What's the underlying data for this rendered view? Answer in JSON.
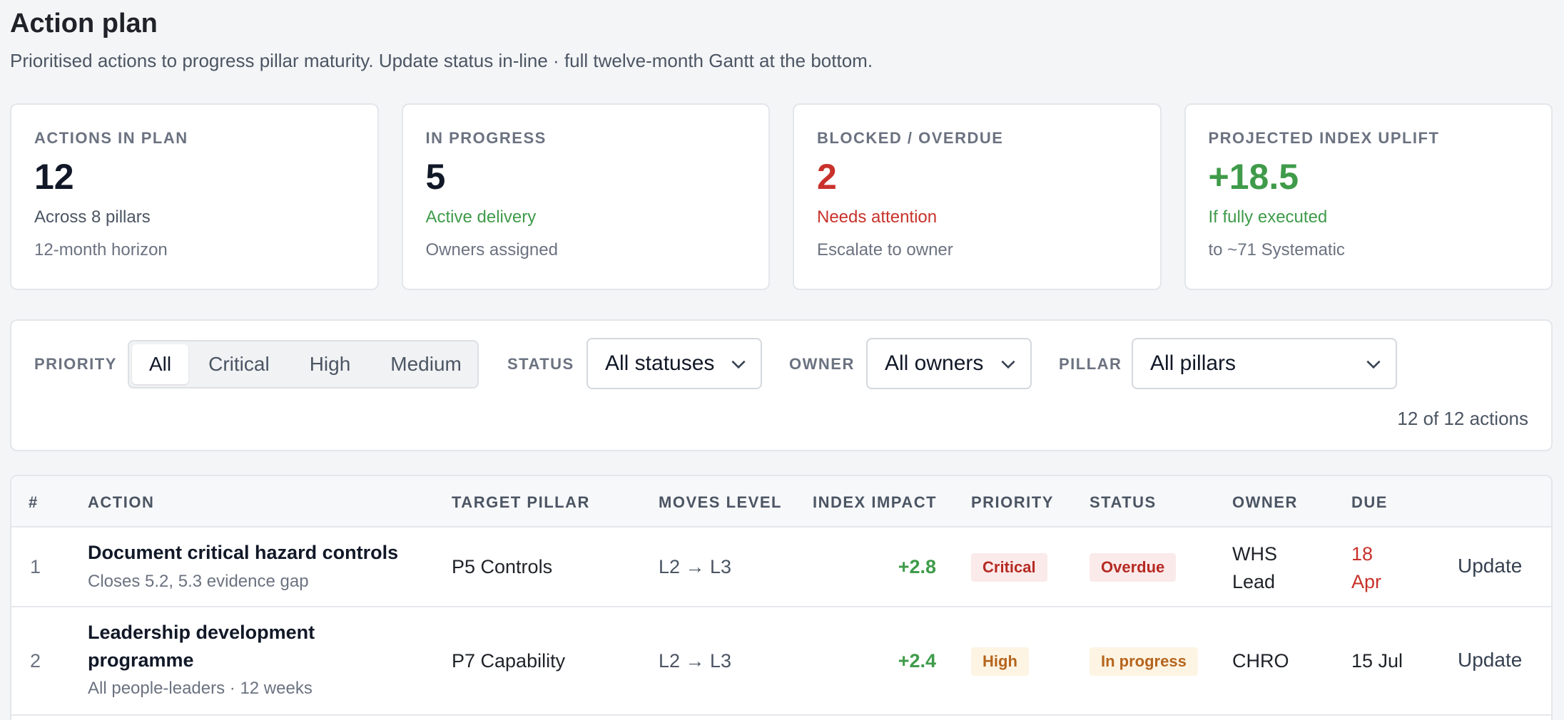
{
  "header": {
    "title": "Action plan",
    "subtitle": "Prioritised actions to progress pillar maturity. Update status in-line · full twelve-month Gantt at the bottom."
  },
  "kpis": [
    {
      "label": "ACTIONS IN PLAN",
      "value": "12",
      "line1": "Across 8 pillars",
      "line2": "12-month horizon"
    },
    {
      "label": "IN PROGRESS",
      "value": "5",
      "line1": "Active delivery",
      "line2": "Owners assigned"
    },
    {
      "label": "BLOCKED / OVERDUE",
      "value": "2",
      "line1": "Needs attention",
      "line2": "Escalate to owner"
    },
    {
      "label": "PROJECTED INDEX UPLIFT",
      "value": "+18.5",
      "line1": "If fully executed",
      "line2": "to ~71 Systematic"
    }
  ],
  "colors": {
    "red": "#c8322b",
    "green": "#3f9b4a"
  },
  "filters": {
    "priority_label": "PRIORITY",
    "priority_options": [
      "All",
      "Critical",
      "High",
      "Medium"
    ],
    "priority_selected": "All",
    "status_label": "STATUS",
    "status_value": "All statuses",
    "owner_label": "OWNER",
    "owner_value": "All owners",
    "pillar_label": "PILLAR",
    "pillar_value": "All pillars",
    "count_text": "12 of 12 actions"
  },
  "table": {
    "columns": [
      "#",
      "ACTION",
      "TARGET PILLAR",
      "MOVES LEVEL",
      "INDEX IMPACT",
      "PRIORITY",
      "STATUS",
      "OWNER",
      "DUE"
    ],
    "rows": [
      {
        "num": "1",
        "title": "Document critical hazard controls",
        "sub": "Closes 5.2, 5.3 evidence gap",
        "pillar": "P5 Controls",
        "level": "L2 → L3",
        "impact": "+2.8",
        "priority": "Critical",
        "status": "Overdue",
        "owner": "WHS Lead",
        "due": "18 Apr",
        "action": "Update"
      },
      {
        "num": "2",
        "title": "Leadership development programme",
        "sub": "All people-leaders · 12 weeks",
        "pillar": "P7 Capability",
        "level": "L2 → L3",
        "impact": "+2.4",
        "priority": "High",
        "status": "In progress",
        "owner": "CHRO",
        "due": "15 Jul",
        "action": "Update"
      }
    ]
  }
}
